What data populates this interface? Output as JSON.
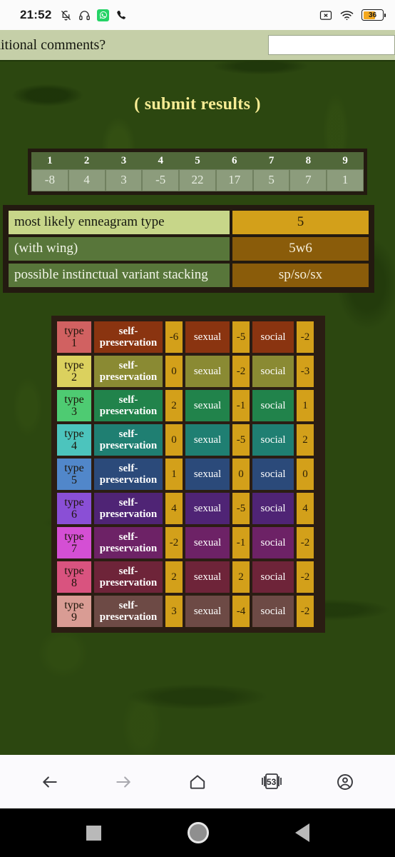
{
  "status_bar": {
    "time": "21:52",
    "battery_percent": "36",
    "icons": [
      "bell-muted-icon",
      "headphones-icon",
      "whatsapp-icon",
      "phone-icon",
      "cast-off-icon",
      "wifi-icon",
      "battery-icon"
    ]
  },
  "form_row": {
    "label": "ditional comments?",
    "input_value": "",
    "input_placeholder": ""
  },
  "heading": {
    "submit_results": "( submit results )"
  },
  "score_table": {
    "types": [
      "1",
      "2",
      "3",
      "4",
      "5",
      "6",
      "7",
      "8",
      "9"
    ],
    "scores": [
      "-8",
      "4",
      "3",
      "-5",
      "22",
      "17",
      "5",
      "7",
      "1"
    ]
  },
  "summary_table": {
    "rows": [
      {
        "label": "most likely enneagram type",
        "value": "5"
      },
      {
        "label": "(with wing)",
        "value": "5w6"
      },
      {
        "label": "possible instinctual variant stacking",
        "value": "sp/so/sx"
      }
    ]
  },
  "variant_table": {
    "sp_label": "self-preservation",
    "sx_label": "sexual",
    "so_label": "social",
    "rows": [
      {
        "type": "type 1",
        "type_color": "#d16161",
        "row_color": "#8a3410",
        "sp": "-6",
        "sx": "-5",
        "so": "-2"
      },
      {
        "type": "type 2",
        "type_color": "#dbd15e",
        "row_color": "#8a8a33",
        "sp": "0",
        "sx": "-2",
        "so": "-3"
      },
      {
        "type": "type 3",
        "type_color": "#4ecb72",
        "row_color": "#21834b",
        "sp": "2",
        "sx": "-1",
        "so": "1"
      },
      {
        "type": "type 4",
        "type_color": "#4cc4bd",
        "row_color": "#1f7f72",
        "sp": "0",
        "sx": "-5",
        "so": "2"
      },
      {
        "type": "type 5",
        "type_color": "#5187ca",
        "row_color": "#2b4a7a",
        "sp": "1",
        "sx": "0",
        "so": "0"
      },
      {
        "type": "type 6",
        "type_color": "#8a4fd6",
        "row_color": "#4f2475",
        "sp": "4",
        "sx": "-5",
        "so": "4"
      },
      {
        "type": "type 7",
        "type_color": "#d44fd4",
        "row_color": "#6d2266",
        "sp": "-2",
        "sx": "-1",
        "so": "-2"
      },
      {
        "type": "type 8",
        "type_color": "#d9537f",
        "row_color": "#6e2439",
        "sp": "2",
        "sx": "2",
        "so": "-2"
      },
      {
        "type": "type 9",
        "type_color": "#d99c94",
        "row_color": "#6d4a45",
        "sp": "3",
        "sx": "-4",
        "so": "-2"
      }
    ]
  },
  "browser_bar": {
    "back": "back-icon",
    "forward": "forward-icon",
    "home": "home-icon",
    "tabs_count": "53",
    "profile": "profile-icon"
  },
  "nav_bar": {
    "recents": "recents-square-icon",
    "home": "home-circle-icon",
    "back": "back-triangle-icon"
  },
  "colors": {
    "page_bg": "#2c4710",
    "accent_gold": "#d3a01a",
    "heading_yellow": "#f7ec94",
    "dark_border": "#231a10"
  }
}
